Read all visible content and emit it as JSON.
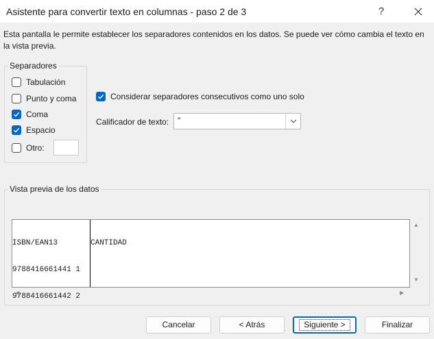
{
  "window": {
    "title": "Asistente para convertir texto en columnas - paso 2 de 3",
    "help_label": "?"
  },
  "description": "Esta pantalla le permite establecer los separadores contenidos en los datos. Se puede ver cómo cambia el texto en la vista previa.",
  "separators": {
    "legend": "Separadores",
    "items": [
      {
        "label": "Tabulación",
        "checked": false
      },
      {
        "label": "Punto y coma",
        "checked": false
      },
      {
        "label": "Coma",
        "checked": true
      },
      {
        "label": "Espacio",
        "checked": true
      },
      {
        "label": "Otro:",
        "checked": false
      }
    ],
    "other_value": ""
  },
  "consecutive": {
    "label": "Considerar separadores consecutivos como uno solo",
    "checked": true
  },
  "qualifier": {
    "label": "Calificador de texto:",
    "value": "\""
  },
  "preview": {
    "legend": "Vista previa de los datos",
    "columns": [
      [
        "ISBN/EAN13",
        "9788416661441 1",
        "9788416661442 2"
      ],
      [
        "CANTIDAD"
      ]
    ]
  },
  "buttons": {
    "cancel": "Cancelar",
    "back": "< Atrás",
    "next": "Siguiente >",
    "finish": "Finalizar"
  },
  "colors": {
    "accent": "#0067c0",
    "background": "#f0f0f0"
  }
}
